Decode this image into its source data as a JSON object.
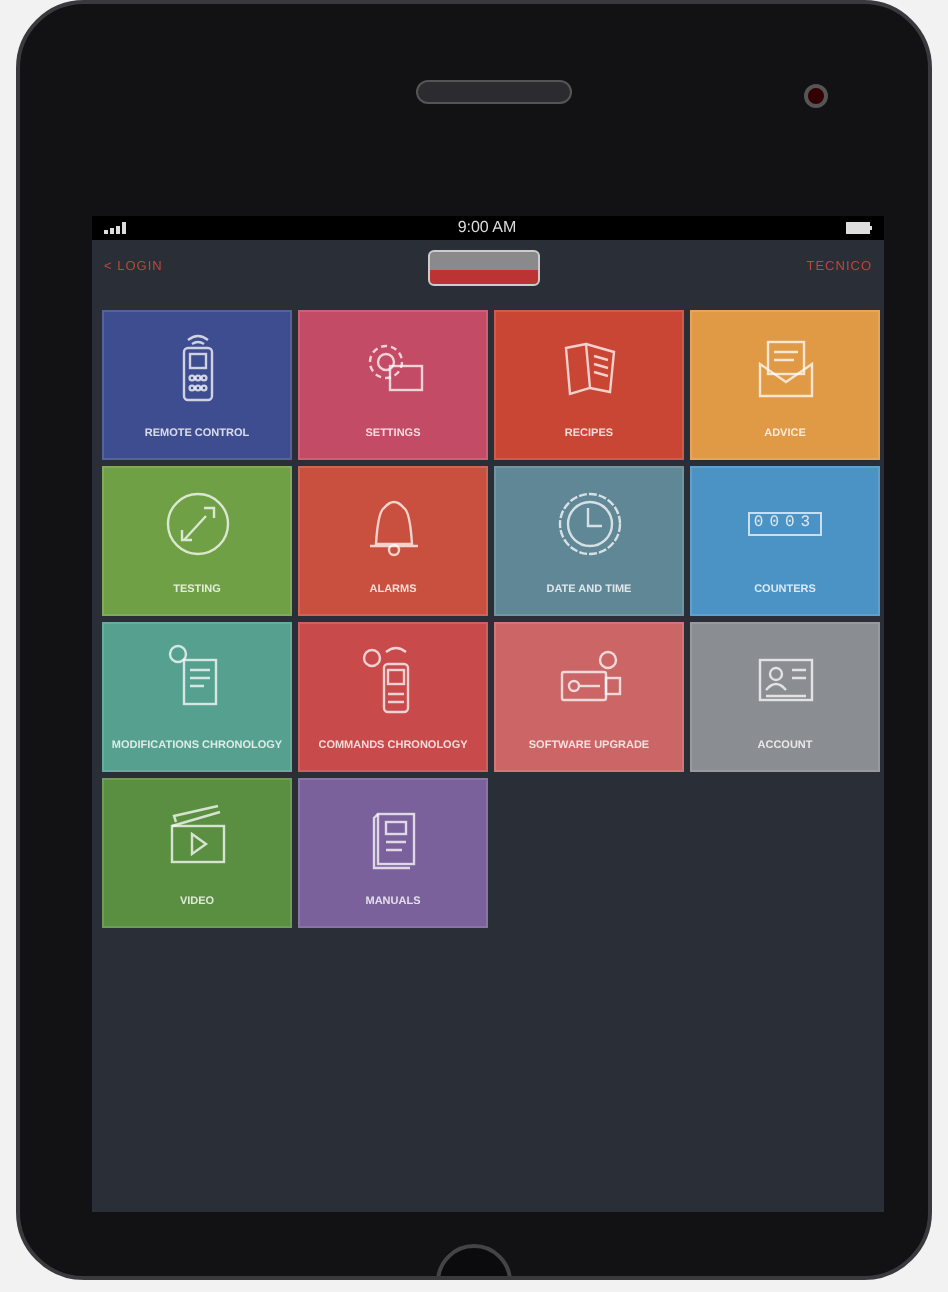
{
  "status_bar": {
    "time": "9:00 AM"
  },
  "nav": {
    "back": "< LOGIN",
    "user": "TECNICO"
  },
  "tiles": [
    {
      "label": "REMOTE CONTROL",
      "color": "#3e4d8f"
    },
    {
      "label": "SETTINGS",
      "color": "#c44b66"
    },
    {
      "label": "RECIPES",
      "color": "#c94534"
    },
    {
      "label": "ADVICE",
      "color": "#e09a45"
    },
    {
      "label": "TESTING",
      "color": "#6fa045"
    },
    {
      "label": "ALARMS",
      "color": "#c9503e"
    },
    {
      "label": "DATE AND TIME",
      "color": "#5f8796"
    },
    {
      "label": "COUNTERS",
      "color": "#4a93c4",
      "display": "0003"
    },
    {
      "label": "MODIFICATIONS CHRONOLOGY",
      "color": "#55a08f"
    },
    {
      "label": "COMMANDS CHRONOLOGY",
      "color": "#c84a4a"
    },
    {
      "label": "SOFTWARE UPGRADE",
      "color": "#cc6565"
    },
    {
      "label": "ACCOUNT",
      "color": "#8a8d92"
    },
    {
      "label": "VIDEO",
      "color": "#5a8f42"
    },
    {
      "label": "MANUALS",
      "color": "#7a619b"
    }
  ]
}
